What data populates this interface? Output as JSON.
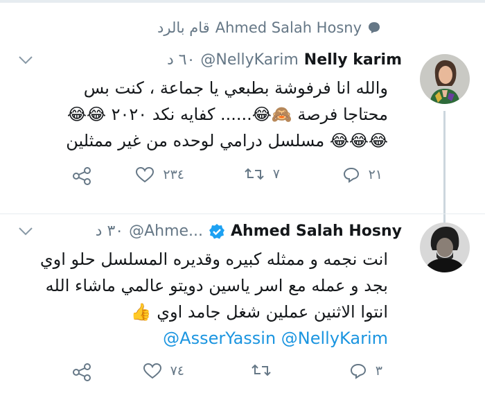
{
  "retweet_notice": {
    "user": "Ahmed Salah Hosny",
    "suffix": "قام بالرد"
  },
  "tweets": [
    {
      "name": "Nelly karim",
      "handle": "@NellyKarim",
      "time": "٦٠ د",
      "lines": [
        "والله انا فرفوشة بطبعي يا جماعة ، كنت بس",
        "محتاجا فرصة 🙈😂...... كفايه نكد ٢٠٢٠ 😂😂",
        "😂😂😂 مسلسل درامي لوحده من غير ممثلين"
      ],
      "replies": "٢١",
      "retweets": "٧",
      "likes": "٢٣٤"
    },
    {
      "name": "Ahmed Salah Hosny",
      "handle": "@Ahme...",
      "time": "٣٠ د",
      "lines": [
        "انت نجمه و ممثله كبيره وقديره المسلسل حلو اوي",
        "بجد و عمله مع اسر ياسين دويتو عالمي ماشاء الله",
        "انتوا الاثنين عملين شغل جامد اوي 👍"
      ],
      "mentions": "@AsserYassin @NellyKarim",
      "replies": "٣",
      "retweets": "",
      "likes": "٧٤"
    }
  ],
  "colors": {
    "link": "#1b95e0",
    "muted": "#657786",
    "verified": "#1da1f2"
  }
}
